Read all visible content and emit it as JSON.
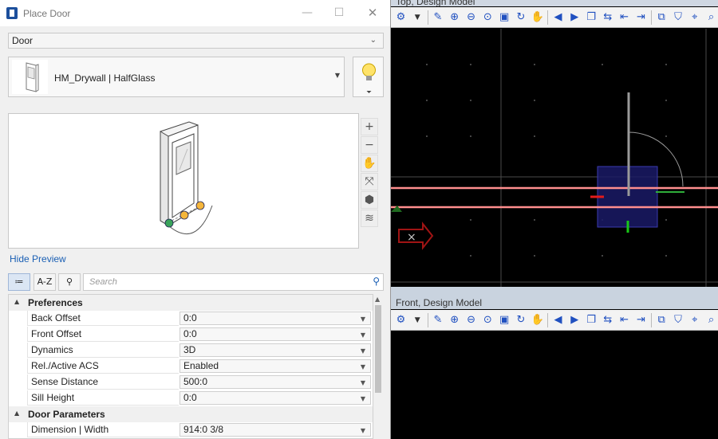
{
  "views": {
    "top": {
      "title": "Top, Design Model"
    },
    "front": {
      "title": "Front, Design Model"
    },
    "toolbar_icons": [
      "view-settings-icon",
      "chevron-down-icon",
      "paint-icon",
      "zoom-in-icon",
      "zoom-out-icon",
      "fit-view-icon",
      "window-area-icon",
      "rotate-icon",
      "pan-icon",
      "previous-view-icon",
      "next-view-icon",
      "copy-view-icon",
      "swap-icon",
      "first-view-icon",
      "last-view-icon",
      "view-clip-icon",
      "clip-volume-icon",
      "camera-icon",
      "more-icon"
    ]
  },
  "dialog": {
    "title": "Place Door",
    "type_value": "Door",
    "family_name": "HM_Drywall | HalfGlass",
    "preview_tools": [
      "zoom-in-icon",
      "zoom-out-icon",
      "pan-hand-icon",
      "fit-view-icon",
      "view-cube-icon",
      "layers-icon"
    ],
    "hide_preview": "Hide Preview",
    "toolbar": {
      "categorized": "≔",
      "alphabetical": "A-Z",
      "filter": "⚲"
    },
    "search_placeholder": "Search",
    "groups": [
      {
        "name": "Preferences",
        "properties": [
          {
            "name": "Back Offset",
            "value": "0:0"
          },
          {
            "name": "Front Offset",
            "value": "0:0"
          },
          {
            "name": "Dynamics",
            "value": "3D"
          },
          {
            "name": "Rel./Active ACS",
            "value": "Enabled"
          },
          {
            "name": "Sense Distance",
            "value": "500:0"
          },
          {
            "name": "Sill Height",
            "value": "0:0"
          }
        ]
      },
      {
        "name": "Door Parameters",
        "properties": [
          {
            "name": "Dimension | Width",
            "value": "914:0 3/8"
          }
        ]
      }
    ]
  },
  "colors": {
    "wall_line": "#ff8e8e",
    "door_box": "#1a1a66",
    "accent": "#1a5fb4"
  }
}
